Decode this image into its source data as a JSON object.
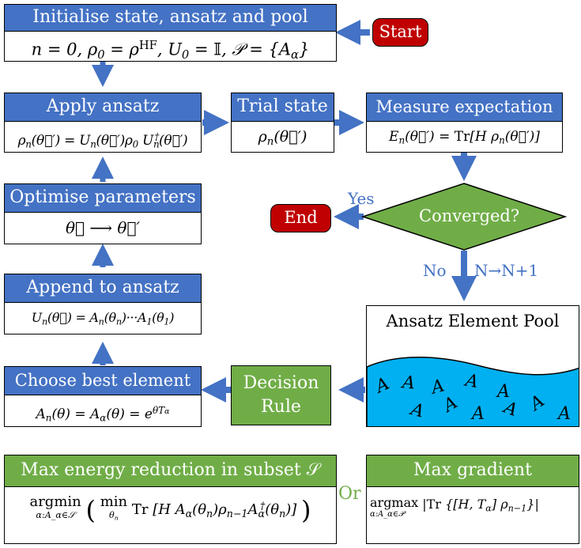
{
  "start": {
    "label": "Start"
  },
  "end": {
    "label": "End"
  },
  "init": {
    "title": "Initialise state, ansatz and pool",
    "formula": "n = 0, ρ₀ = ρᴴᶠ, U₀ = 𝕀, 𝒫 = {A_α}"
  },
  "apply": {
    "title": "Apply ansatz",
    "formula": "ρₙ(θ⃗′) = Uₙ(θ⃗′) ρ₀ Uₙ†(θ⃗′)"
  },
  "trial": {
    "title": "Trial state",
    "formula": "ρₙ(θ⃗′)"
  },
  "measure": {
    "title": "Measure expectation",
    "formula": "Eₙ(θ⃗′) = Tr[H ρₙ(θ⃗′)]"
  },
  "optimise": {
    "title": "Optimise parameters",
    "formula": "θ⃗ ⟶ θ⃗′"
  },
  "converged": {
    "label": "Converged?",
    "yes_label": "Yes",
    "no_label": "No",
    "increment_label": "N→N+1"
  },
  "append": {
    "title": "Append to ansatz",
    "formula": "Uₙ(θ⃗) = Aₙ(θₙ)···A₁(θ₁)"
  },
  "pool": {
    "title": "Ansatz Element Pool",
    "element_symbol": "A"
  },
  "decision": {
    "line1": "Decision",
    "line2": "Rule"
  },
  "choose": {
    "title": "Choose best element",
    "formula": "Aₙ(θ) = A_α(θ) = e^{θT_α}"
  },
  "rule_energy": {
    "title": "Max energy reduction in subset 𝒮",
    "operator": "argmin",
    "subscript": "α:A_α∈𝒮",
    "formula": "( min_θₙ Tr [ H A_α(θₙ) ρₙ₋₁ A_α†(θₙ) ] )"
  },
  "or_label": "Or",
  "rule_gradient": {
    "title": "Max gradient",
    "operator": "argmax",
    "subscript": "α:A_α∈𝒫",
    "formula": "|Tr {[H, T_α] ρₙ₋₁}|"
  },
  "colors": {
    "blue": "#4472c4",
    "green": "#70ad47",
    "red": "#c00000",
    "pool_water": "#00b0f0"
  }
}
